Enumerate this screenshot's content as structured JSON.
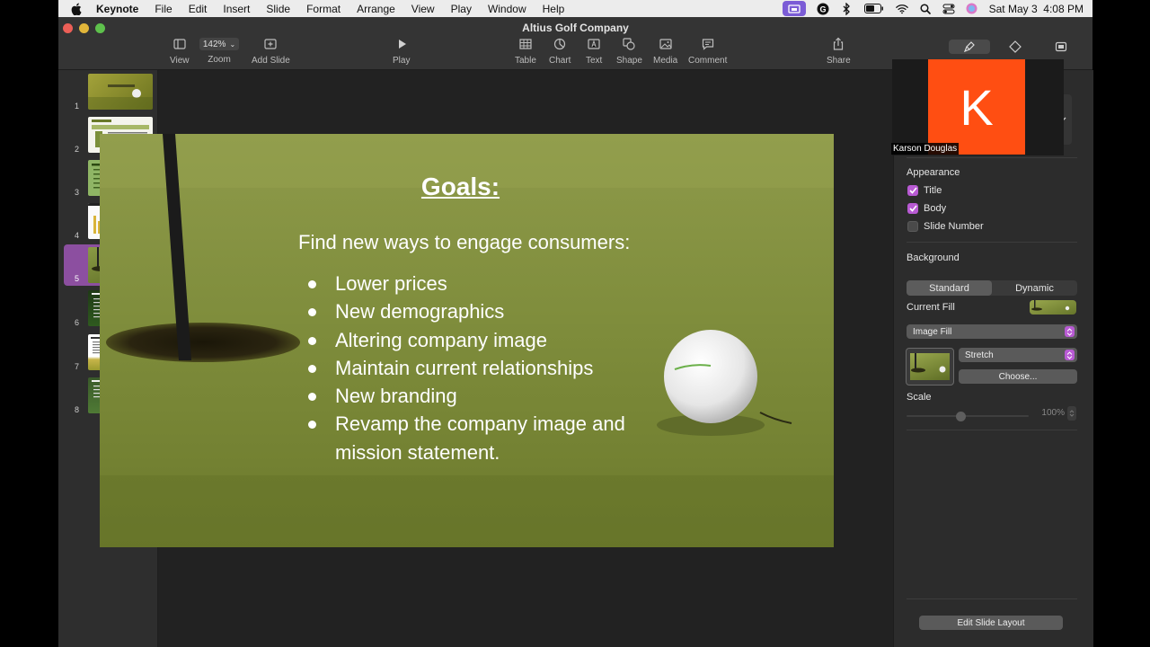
{
  "menubar": {
    "app": "Keynote",
    "items": [
      "File",
      "Edit",
      "Insert",
      "Slide",
      "Format",
      "Arrange",
      "View",
      "Play",
      "Window",
      "Help"
    ],
    "datetime": "Sat May 3  4:08 PM"
  },
  "window": {
    "title": "Altius Golf Company"
  },
  "toolbar": {
    "view": "View",
    "zoom_value": "142%",
    "zoom": "Zoom",
    "add_slide": "Add Slide",
    "play": "Play",
    "table": "Table",
    "chart": "Chart",
    "text": "Text",
    "shape": "Shape",
    "media": "Media",
    "comment": "Comment",
    "share": "Share"
  },
  "navigator": {
    "slides": [
      {
        "num": "1"
      },
      {
        "num": "2"
      },
      {
        "num": "3"
      },
      {
        "num": "4"
      },
      {
        "num": "5",
        "selected": true
      },
      {
        "num": "6"
      },
      {
        "num": "7"
      },
      {
        "num": "8"
      }
    ]
  },
  "slide": {
    "title": "Goals:",
    "intro": "Find new ways to engage consumers:",
    "bullets": [
      "Lower prices",
      "New demographics",
      "Altering company image",
      "Maintain current relationships",
      "New branding",
      "Revamp the  company image and mission statement."
    ]
  },
  "participant": {
    "initial": "K",
    "name": "Karson Douglas",
    "tile_color": "#ff4e12"
  },
  "inspector": {
    "appearance": {
      "heading": "Appearance",
      "title": {
        "label": "Title",
        "checked": true
      },
      "body": {
        "label": "Body",
        "checked": true
      },
      "slide_number": {
        "label": "Slide Number",
        "checked": false
      }
    },
    "background": {
      "heading": "Background",
      "tabs": [
        "Standard",
        "Dynamic"
      ],
      "active_tab": "Standard",
      "current_fill_label": "Current Fill",
      "fill_type": "Image Fill",
      "scaling": "Stretch",
      "choose": "Choose...",
      "scale_label": "Scale",
      "scale_value": "100%"
    },
    "edit_layout": "Edit Slide Layout"
  },
  "colors": {
    "accent": "#b85ad3",
    "selection": "#8c4fa0"
  }
}
